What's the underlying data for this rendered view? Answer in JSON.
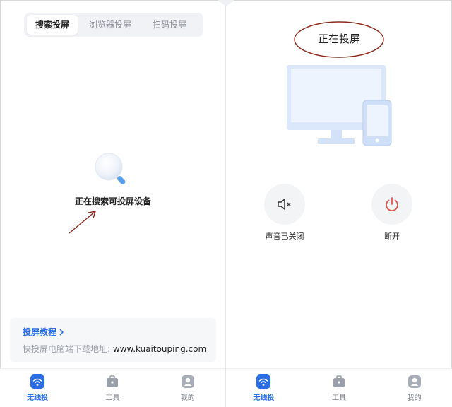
{
  "left_panel": {
    "mode_tabs": [
      {
        "label": "搜索投屏",
        "active": true
      },
      {
        "label": "浏览器投屏",
        "active": false
      },
      {
        "label": "扫码投屏",
        "active": false
      }
    ],
    "searching_text": "正在搜索可投屏设备",
    "guide": {
      "link_label": "投屏教程",
      "download_label": "快投屏电脑端下载地址: ",
      "download_url": "www.kuaitouping.com"
    }
  },
  "right_panel": {
    "status_title": "正在投屏",
    "controls": [
      {
        "label": "声音已关闭",
        "icon": "speaker-muted-icon"
      },
      {
        "label": "断开",
        "icon": "power-icon"
      }
    ]
  },
  "tab_bar": {
    "items": [
      {
        "label": "无线投",
        "icon": "wifi-cast-icon",
        "active": true
      },
      {
        "label": "工具",
        "icon": "toolbox-icon",
        "active": false
      },
      {
        "label": "我的",
        "icon": "user-icon",
        "active": false
      }
    ]
  },
  "colors": {
    "accent": "#2a6ee6",
    "annotation": "#8b2a1e",
    "power": "#e0524a",
    "illustration": "#dbe8fb"
  }
}
